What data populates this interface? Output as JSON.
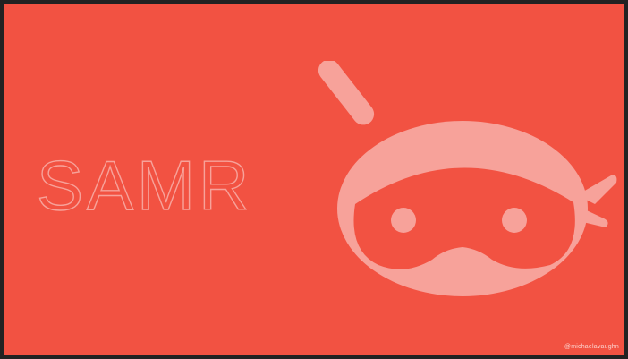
{
  "slide": {
    "title": "SAMR",
    "credit": "@michaelavaughn",
    "logo_icon": "ninja-mascot-icon"
  },
  "colors": {
    "background": "#f25242",
    "title_outline": "#f7a29a",
    "mascot": "#f7a29a"
  }
}
